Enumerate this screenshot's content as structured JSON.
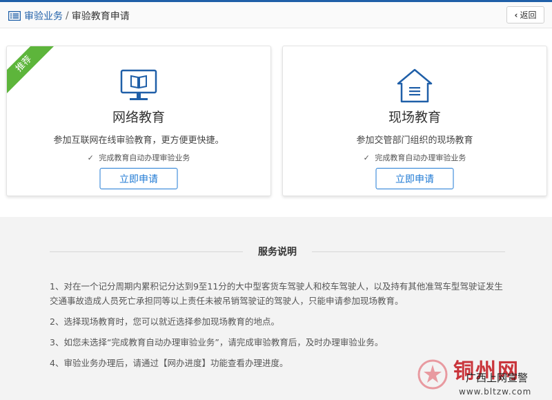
{
  "breadcrumb": {
    "parent": "审验业务",
    "separator": "/",
    "current": "审验教育申请"
  },
  "back_button": {
    "label": "返回"
  },
  "cards": [
    {
      "ribbon": "推荐",
      "icon": "monitor-book-icon",
      "title": "网络教育",
      "description": "参加互联网在线审验教育，更方便更快捷。",
      "check_label": "完成教育自动办理审验业务",
      "button_label": "立即申请"
    },
    {
      "icon": "house-document-icon",
      "title": "现场教育",
      "description": "参加交管部门组织的现场教育",
      "check_label": "完成教育自动办理审验业务",
      "button_label": "立即申请"
    }
  ],
  "service": {
    "title": "服务说明",
    "items": [
      "1、对在一个记分周期内累积记分达到9至11分的大中型客货车驾驶人和校车驾驶人，以及持有其他准驾车型驾驶证发生交通事故造成人员死亡承担同等以上责任未被吊销驾驶证的驾驶人，只能申请参加现场教育。",
      "2、选择现场教育时，您可以就近选择参加现场教育的地点。",
      "3、如您未选择“完成教育自动办理审验业务”，请完成审验教育后，及时办理审验业务。",
      "4、审验业务办理后，请通过【网办进度】功能查看办理进度。"
    ]
  },
  "watermark": {
    "title": "铜州网",
    "subtitle": "广西上网宣警",
    "url": "www.bltzw.com"
  },
  "colors": {
    "brand_blue": "#1f5fa8",
    "button_blue": "#1f7ad4",
    "ribbon_green": "#5db53b",
    "watermark_red": "#c9353b"
  }
}
